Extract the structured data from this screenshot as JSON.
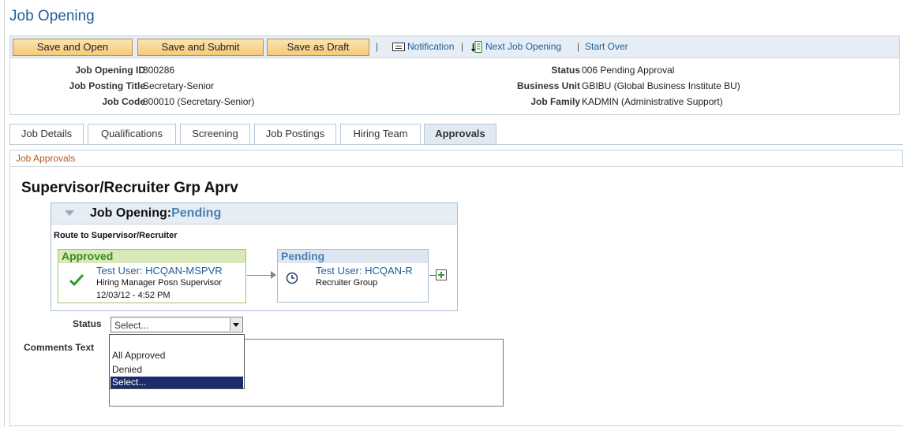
{
  "page": {
    "title": "Job Opening"
  },
  "toolbar": {
    "save_open": "Save and Open",
    "save_submit": "Save and Submit",
    "save_draft": "Save as Draft",
    "separator": "|",
    "notification": "Notification",
    "next_job_opening": "Next Job Opening",
    "start_over": "Start Over"
  },
  "header": {
    "job_opening_id_label": "Job Opening ID",
    "job_opening_id": "300286",
    "job_posting_title_label": "Job Posting Title",
    "job_posting_title": "Secretary-Senior",
    "job_code_label": "Job Code",
    "job_code": "800010 (Secretary-Senior)",
    "status_label": "Status",
    "status": "006 Pending Approval",
    "business_unit_label": "Business Unit",
    "business_unit": "GBIBU (Global Business Institute BU)",
    "job_family_label": "Job Family",
    "job_family": "KADMIN (Administrative Support)"
  },
  "tabs": [
    {
      "label": "Job Details"
    },
    {
      "label": "Qualifications"
    },
    {
      "label": "Screening"
    },
    {
      "label": "Job Postings"
    },
    {
      "label": "Hiring Team"
    },
    {
      "label": "Approvals",
      "active": true
    }
  ],
  "section": {
    "title": "Job Approvals"
  },
  "approval": {
    "stage_title": "Supervisor/Recruiter Grp Aprv",
    "flow_title": "Job Opening:",
    "flow_status": "Pending",
    "route_label": "Route to Supervisor/Recruiter",
    "steps": [
      {
        "state": "Approved",
        "user": "Test User: HCQAN-MSPVR",
        "role": "Hiring Manager Posn Supervisor",
        "datetime": "12/03/12 - 4:52 PM"
      },
      {
        "state": "Pending",
        "user": "Test User: HCQAN-R",
        "role": "Recruiter Group"
      }
    ]
  },
  "form": {
    "status_label": "Status",
    "status_value": "Select...",
    "status_options": [
      "All Approved",
      "Denied",
      "Select..."
    ],
    "comments_label": "Comments Text"
  },
  "colors": {
    "link": "#1f5f9a",
    "approved": "#3d8a1f",
    "pending": "#4a7fb5",
    "button": "#f6c978"
  }
}
